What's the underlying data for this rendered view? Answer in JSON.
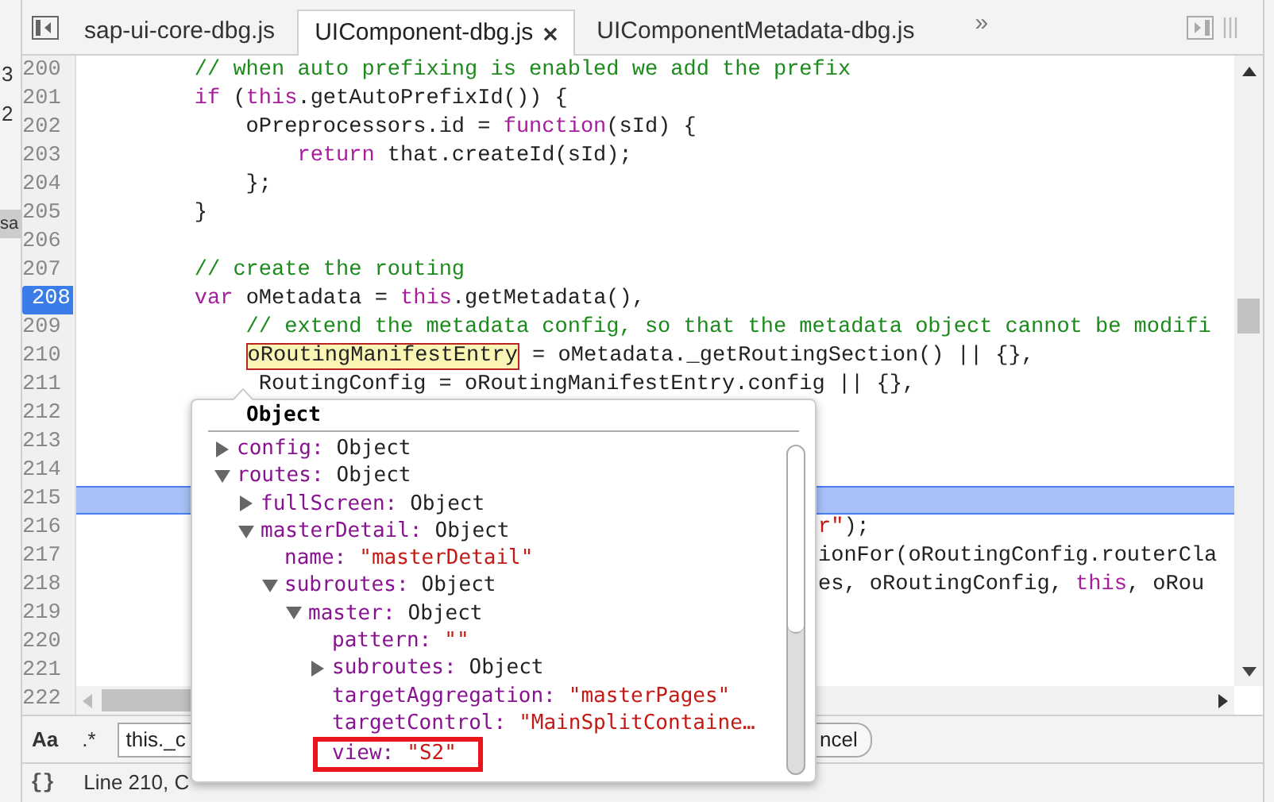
{
  "side_strip": {
    "texts": [
      "3",
      "2"
    ],
    "tab": "sa"
  },
  "tabs": [
    {
      "label": "sap-ui-core-dbg.js",
      "selected": false,
      "closable": false
    },
    {
      "label": "UIComponent-dbg.js",
      "selected": true,
      "closable": true
    },
    {
      "label": "UIComponentMetadata-dbg.js",
      "selected": false,
      "closable": false
    }
  ],
  "more_tabs": "»",
  "code_lines": [
    {
      "number": "200",
      "segments": [
        {
          "kind": "comment",
          "text": "    // when auto prefixing is enabled we add the prefix"
        }
      ]
    },
    {
      "number": "201",
      "segments": [
        {
          "kind": "keyword",
          "text": "    if"
        },
        {
          "kind": "plain",
          "text": " ("
        },
        {
          "kind": "keyword",
          "text": "this"
        },
        {
          "kind": "plain",
          "text": ".getAutoPrefixId()) {"
        }
      ]
    },
    {
      "number": "202",
      "segments": [
        {
          "kind": "plain",
          "text": "        oPreprocessors.id = "
        },
        {
          "kind": "keyword",
          "text": "function"
        },
        {
          "kind": "plain",
          "text": "(sId) {"
        }
      ]
    },
    {
      "number": "203",
      "segments": [
        {
          "kind": "keyword",
          "text": "            return"
        },
        {
          "kind": "plain",
          "text": " that.createId(sId);"
        }
      ]
    },
    {
      "number": "204",
      "segments": [
        {
          "kind": "plain",
          "text": "        };"
        }
      ]
    },
    {
      "number": "205",
      "segments": [
        {
          "kind": "plain",
          "text": "    }"
        }
      ]
    },
    {
      "number": "206"
    },
    {
      "number": "207",
      "segments": [
        {
          "kind": "comment",
          "text": "    // create the routing"
        }
      ]
    },
    {
      "number": "208",
      "breakpoint": true,
      "segments": [
        {
          "kind": "keyword",
          "text": "    var"
        },
        {
          "kind": "plain",
          "text": " oMetadata = "
        },
        {
          "kind": "keyword",
          "text": "this"
        },
        {
          "kind": "plain",
          "text": ".getMetadata(),"
        }
      ]
    },
    {
      "number": "209",
      "segments": [
        {
          "kind": "comment",
          "text": "        // extend the metadata config, so that the metadata object cannot be modifi"
        }
      ]
    },
    {
      "number": "210",
      "kind": "continuation",
      "segments": [
        {
          "kind": "hover",
          "text": "oRoutingManifestEntry"
        },
        {
          "kind": "plain",
          "text": " = oMetadata._getRoutingSection() || {},"
        }
      ]
    },
    {
      "number": "211",
      "kind": "covered_continuation",
      "segments": [
        {
          "kind": "plain",
          "text": "RoutingConfig = oRoutingManifestEntry.config || {},"
        }
      ]
    },
    {
      "number": "212"
    },
    {
      "number": "213"
    },
    {
      "number": "214"
    },
    {
      "number": "215",
      "highlighted": true
    },
    {
      "number": "216",
      "behind_popover": true,
      "segments": [
        {
          "kind": "string",
          "text": "r\""
        },
        {
          "kind": "plain",
          "text": ");"
        }
      ]
    },
    {
      "number": "217",
      "behind_popover": true,
      "segments": [
        {
          "kind": "plain",
          "text": "ionFor(oRoutingConfig.routerCla"
        }
      ]
    },
    {
      "number": "218",
      "behind_popover": true,
      "segments": [
        {
          "kind": "plain",
          "text": "es, oRoutingConfig, "
        },
        {
          "kind": "keyword",
          "text": "this"
        },
        {
          "kind": "plain",
          "text": ", oRou"
        }
      ]
    },
    {
      "number": "219"
    },
    {
      "number": "220"
    },
    {
      "number": "221"
    },
    {
      "number": "222"
    }
  ],
  "popover": {
    "title": "Object",
    "tree": [
      {
        "key": "config:",
        "value": "Object",
        "kind": "object",
        "expanded": false
      },
      {
        "key": "routes:",
        "value": "Object",
        "kind": "object",
        "expanded": true,
        "children": [
          {
            "key": "fullScreen:",
            "value": "Object",
            "kind": "object",
            "expanded": false
          },
          {
            "key": "masterDetail:",
            "value": "Object",
            "kind": "object",
            "expanded": true,
            "children": [
              {
                "key": "name:",
                "value": "\"masterDetail\"",
                "kind": "string"
              },
              {
                "key": "subroutes:",
                "value": "Object",
                "kind": "object",
                "expanded": true,
                "children": [
                  {
                    "key": "master:",
                    "value": "Object",
                    "kind": "object",
                    "expanded": true,
                    "children": [
                      {
                        "key": "pattern:",
                        "value": "\"\"",
                        "kind": "string"
                      },
                      {
                        "key": "subroutes:",
                        "value": "Object",
                        "kind": "object",
                        "expanded": false
                      },
                      {
                        "key": "targetAggregation:",
                        "value": "\"masterPages\"",
                        "kind": "string"
                      },
                      {
                        "key": "targetControl:",
                        "value": "\"MainSplitContaine…",
                        "kind": "string"
                      },
                      {
                        "key": "view:",
                        "value": "\"S2\"",
                        "kind": "string",
                        "annotated": true
                      }
                    ]
                  }
                ]
              }
            ]
          }
        ]
      }
    ]
  },
  "search_bar": {
    "case_toggle": "Aa",
    "regex_toggle": ".*",
    "value": "this._c",
    "cancel": "ncel"
  },
  "status_bar": {
    "format_icon": "{}",
    "text": "Line 210, C"
  }
}
